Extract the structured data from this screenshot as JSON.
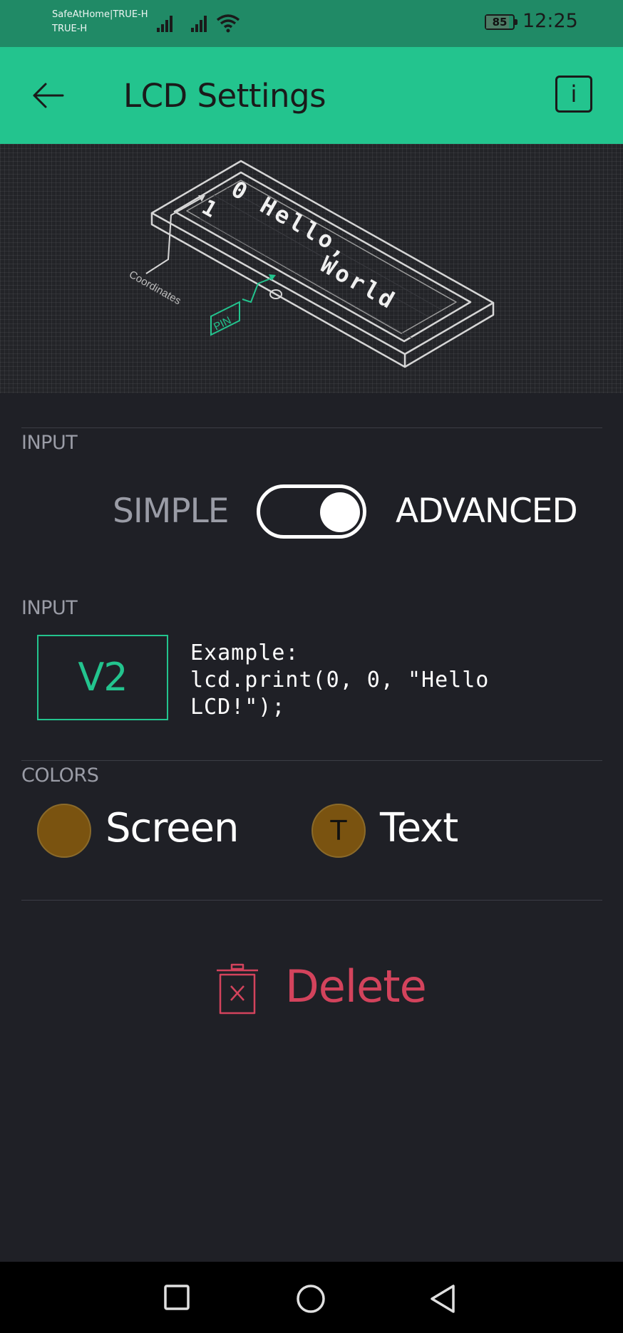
{
  "status_bar": {
    "carrier_line1": "SafeAtHome|TRUE-H",
    "carrier_line2": "TRUE-H",
    "battery": "85",
    "battery_level": 0.85,
    "time": "12:25"
  },
  "header": {
    "title": "LCD Settings",
    "info_label": "i",
    "back_icon": "arrow-left-icon",
    "background": "#23c48e"
  },
  "illustration": {
    "line0": "0 Hello,",
    "line1": "World",
    "row_marker": "1",
    "label_coordinates": "Coordinates",
    "label_pin": "PIN"
  },
  "input_mode": {
    "label": "INPUT",
    "option_simple": "SIMPLE",
    "option_advanced": "ADVANCED",
    "selected": "ADVANCED"
  },
  "pin_input": {
    "label": "INPUT",
    "value": "V2",
    "example": "Example:\nlcd.print(0, 0, \"Hello\nLCD!\");"
  },
  "colors": {
    "label": "COLORS",
    "screen_label": "Screen",
    "text_label": "Text",
    "text_swatch_glyph": "T",
    "screen_color": "#7a5310",
    "text_color": "#7a5310"
  },
  "delete": {
    "label": "Delete",
    "icon": "trash-icon",
    "color": "#d3435c"
  },
  "nav_bar": {
    "recents_icon": "square-icon",
    "home_icon": "circle-icon",
    "back_icon": "triangle-back-icon"
  }
}
